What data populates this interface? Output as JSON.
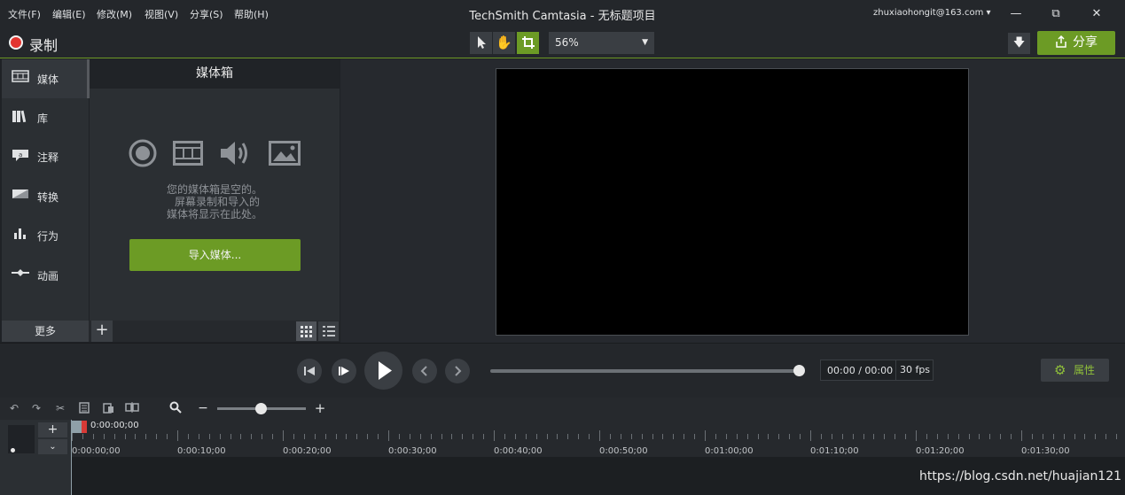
{
  "menu": [
    "文件(F)",
    "编辑(E)",
    "修改(M)",
    "视图(V)",
    "分享(S)",
    "帮助(H)"
  ],
  "title": "TechSmith Camtasia - 无标题项目",
  "account": "zhuxiaohongit@163.com ▾",
  "toolbar": {
    "record_label": "录制",
    "zoom_value": "56%",
    "share_label": "分享"
  },
  "left_tabs": [
    {
      "label": "媒体",
      "icon": "film-icon"
    },
    {
      "label": "库",
      "icon": "library-icon"
    },
    {
      "label": "注释",
      "icon": "annotation-icon"
    },
    {
      "label": "转换",
      "icon": "transition-icon"
    },
    {
      "label": "行为",
      "icon": "behavior-icon"
    },
    {
      "label": "动画",
      "icon": "animation-icon"
    }
  ],
  "media_bin": {
    "header": "媒体箱",
    "empty_line1": "您的媒体箱是空的。",
    "empty_line2": "屏幕录制和导入的",
    "empty_line3": "媒体将显示在此处。",
    "import_button": "导入媒体..."
  },
  "left_bottom": {
    "more": "更多",
    "add": "+"
  },
  "playback": {
    "time": "00:00 / 00:00",
    "fps": "30 fps",
    "properties": "属性"
  },
  "timeline": {
    "playhead_time": "0:00:00;00",
    "ticks": [
      "0:00:00;00",
      "0:00:10;00",
      "0:00:20;00",
      "0:00:30;00",
      "0:00:40;00",
      "0:00:50;00",
      "0:01:00;00",
      "0:01:10;00",
      "0:01:20;00",
      "0:01:30;00"
    ]
  },
  "watermark": "https://blog.csdn.net/huajian121",
  "colors": {
    "accent": "#6c9b25",
    "record": "#e3342f",
    "background": "#1f2226"
  }
}
